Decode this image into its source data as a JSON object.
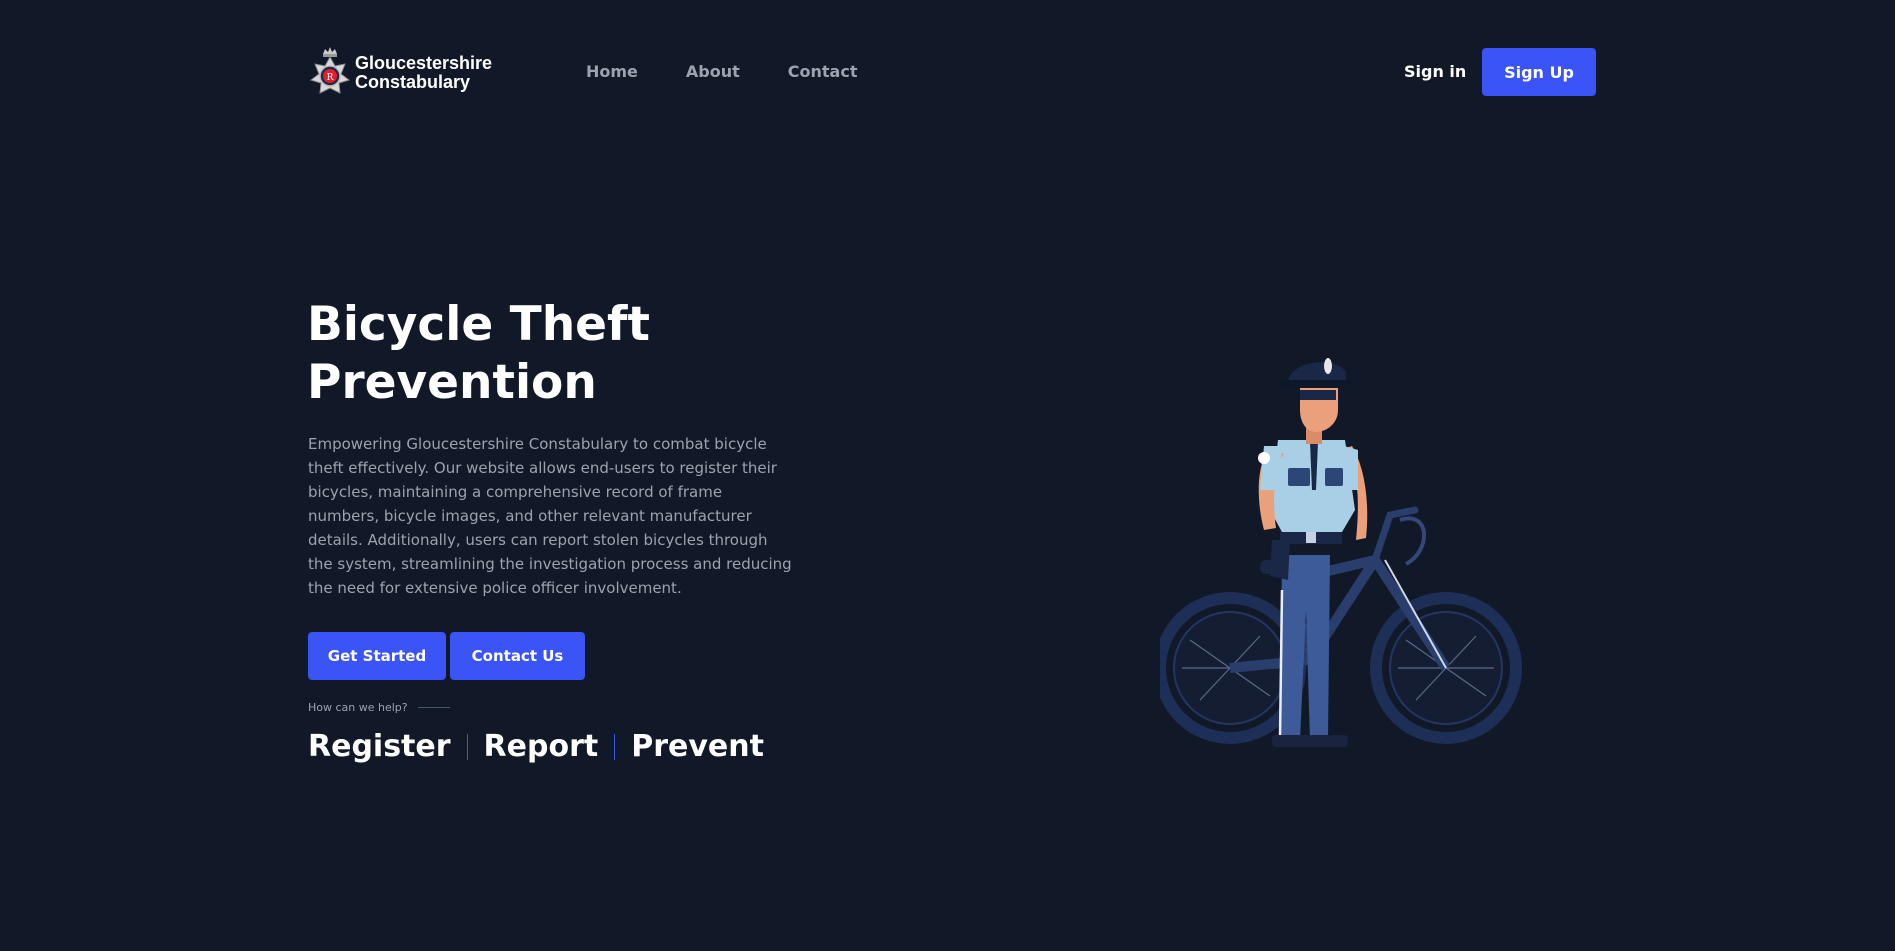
{
  "header": {
    "logo_line1": "Gloucestershire",
    "logo_line2": "Constabulary",
    "nav": [
      {
        "label": "Home"
      },
      {
        "label": "About"
      },
      {
        "label": "Contact"
      }
    ],
    "signin_label": "Sign in",
    "signup_label": "Sign Up"
  },
  "hero": {
    "title_line1": "Bicycle Theft",
    "title_line2": "Prevention",
    "description": "Empowering Gloucestershire Constabulary to combat bicycle theft effectively. Our website allows end-users to register their bicycles, maintaining a comprehensive record of frame numbers, bicycle images, and other relevant manufacturer details. Additionally, users can report stolen bicycles through the system, streamlining the investigation process and reducing the need for extensive police officer involvement.",
    "get_started_label": "Get Started",
    "contact_us_label": "Contact Us",
    "help_text": "How can we help?",
    "pillars": [
      "Register",
      "Report",
      "Prevent"
    ]
  },
  "colors": {
    "background": "#111827",
    "accent": "#3b54f6",
    "muted_text": "#9ca3af"
  },
  "icons": {
    "logo": "police-crest-icon",
    "illustration": "police-officer-with-bicycle"
  }
}
